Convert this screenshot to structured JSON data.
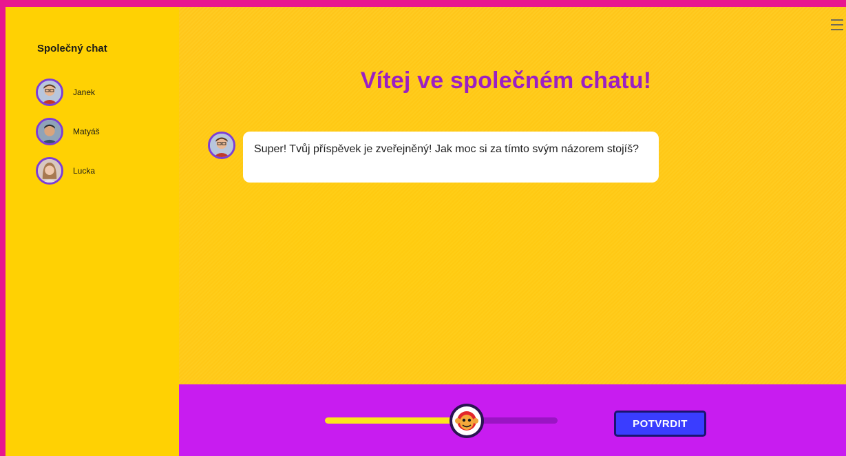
{
  "sidebar": {
    "title": "Společný chat",
    "users": [
      {
        "name": "Janek",
        "avatar_icon": "avatar-photo-janek"
      },
      {
        "name": "Matyáš",
        "avatar_icon": "avatar-photo-matyas"
      },
      {
        "name": "Lucka",
        "avatar_icon": "avatar-photo-lucka"
      }
    ]
  },
  "main": {
    "title": "Vítej ve společném chatu!",
    "menu_icon": "hamburger-menu-icon",
    "messages": [
      {
        "author_avatar": "avatar-photo-janek",
        "text": "Super! Tvůj příspěvek je zveřejněný! Jak moc si za tímto svým názorem stojíš?"
      }
    ]
  },
  "footer": {
    "slider": {
      "value": 0.61,
      "handle_icon": "monkey-face-icon"
    },
    "confirm_label": "POTVRDIT"
  },
  "colors": {
    "frame": "#e8168f",
    "sidebar": "#ffd103",
    "main_bg": "#ffc819",
    "title": "#9b1fc4",
    "bottom_bar": "#c81cf0",
    "slider_fill": "#fde51e",
    "button": "#3a3dff"
  }
}
